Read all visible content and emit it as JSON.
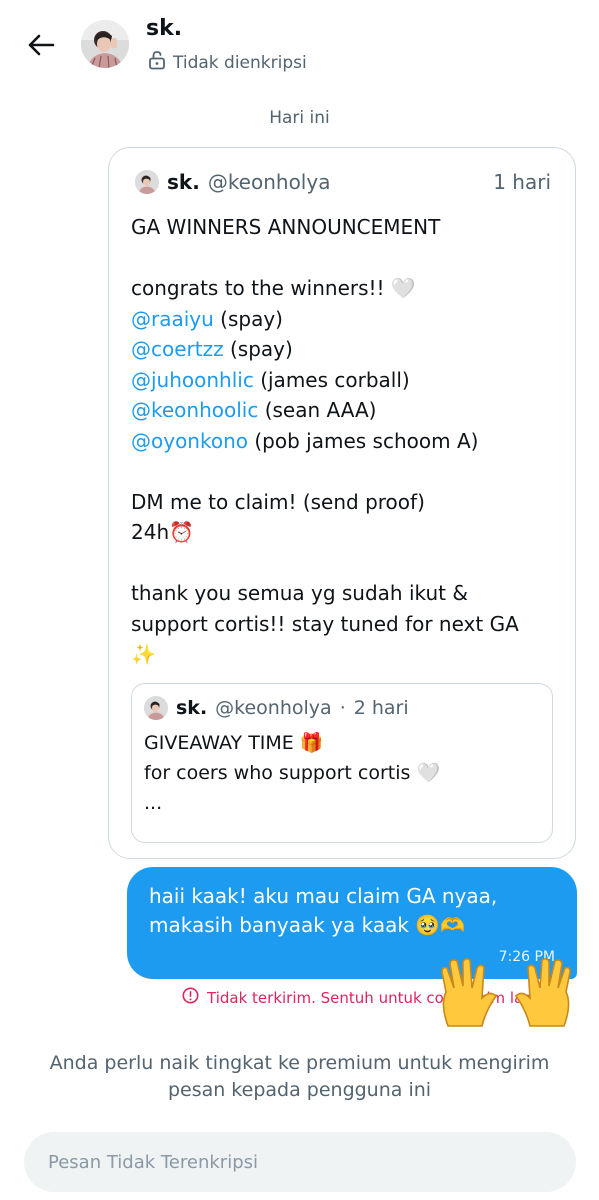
{
  "header": {
    "name": "sk.",
    "encryption_status": "Tidak dienkripsi"
  },
  "date_separator": "Hari ini",
  "shared_tweet": {
    "name": "sk.",
    "handle": "@keonholya",
    "time": "1 hari",
    "title": "GA WINNERS ANNOUNCEMENT",
    "congrats": "congrats to the winners!! 🤍",
    "winners": [
      {
        "mention": "@raaiyu",
        "note": " (spay)"
      },
      {
        "mention": "@coertzz",
        "note": " (spay)"
      },
      {
        "mention": "@juhoonhlic",
        "note": " (james corball)"
      },
      {
        "mention": "@keonhoolic",
        "note": " (sean AAA)"
      },
      {
        "mention": "@oyonkono",
        "note": " (pob james schoom A)"
      }
    ],
    "claim_line": "DM me to claim! (send proof)",
    "deadline": "24h⏰",
    "thanks_line_1": "thank you semua yg sudah ikut &",
    "thanks_line_2": "support cortis!! stay tuned for next GA",
    "sparkles": "✨",
    "quoted": {
      "name": "sk.",
      "handle": "@keonholya",
      "dot": "·",
      "time": "2 hari",
      "line_1": "GIVEAWAY TIME 🎁",
      "line_2": "for coers who support cortis 🤍",
      "line_3": "..."
    }
  },
  "message": {
    "line_1": "haii kaak! aku mau claim GA nyaa,",
    "line_2": "makasih banyaak ya kaak 🥹🫶",
    "time": "7:26 PM"
  },
  "error_text": "Tidak terkirim. Sentuh untuk coba kirim lagi",
  "premium_note": "Anda perlu naik tingkat ke premium untuk mengirim pesan kepada pengguna ini",
  "composer": {
    "placeholder": "Pesan Tidak Terenkripsi"
  },
  "colors": {
    "accent": "#1d9bf0",
    "error": "#e0245e",
    "muted": "#536471"
  }
}
